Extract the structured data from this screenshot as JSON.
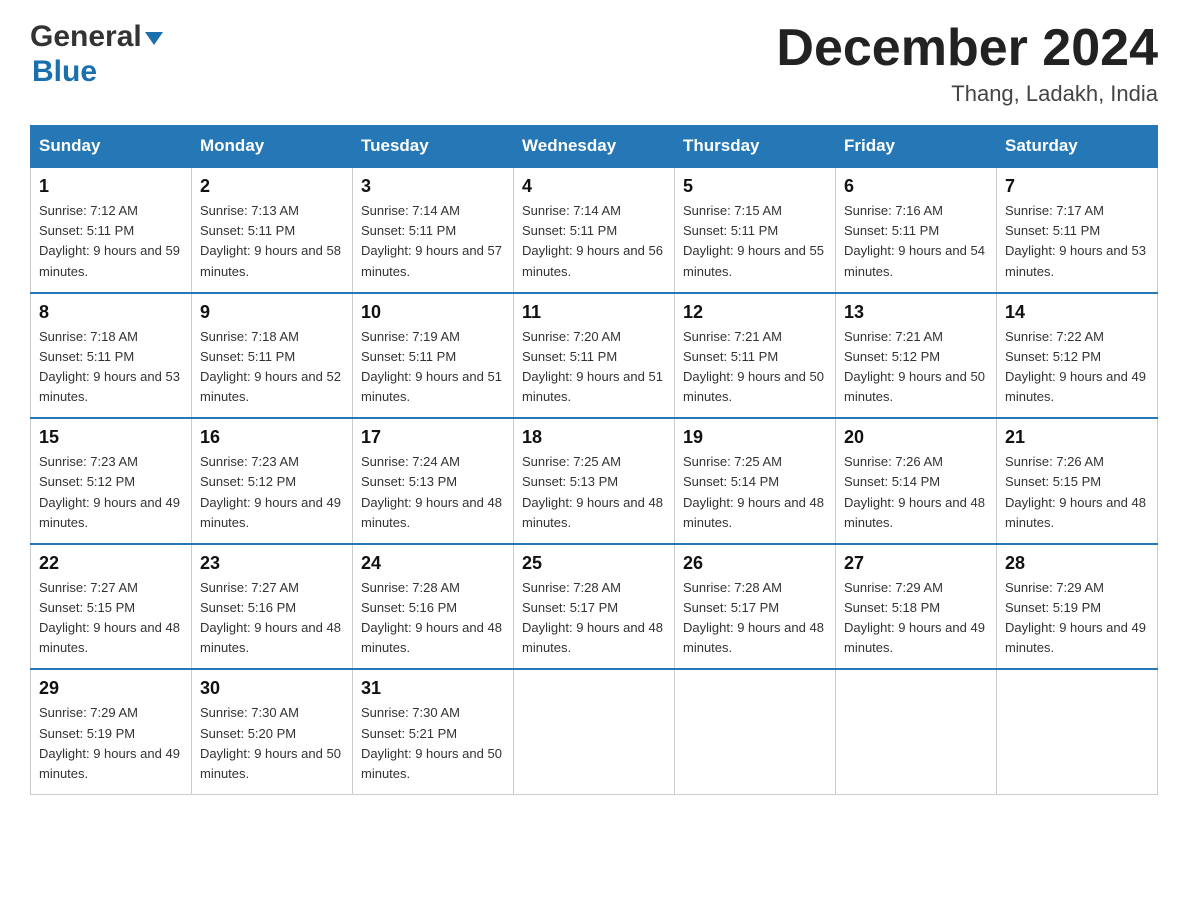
{
  "header": {
    "logo_line1": "General",
    "logo_line2": "Blue",
    "month_year": "December 2024",
    "location": "Thang, Ladakh, India"
  },
  "weekdays": [
    "Sunday",
    "Monday",
    "Tuesday",
    "Wednesday",
    "Thursday",
    "Friday",
    "Saturday"
  ],
  "weeks": [
    [
      {
        "day": "1",
        "sunrise": "7:12 AM",
        "sunset": "5:11 PM",
        "daylight": "9 hours and 59 minutes."
      },
      {
        "day": "2",
        "sunrise": "7:13 AM",
        "sunset": "5:11 PM",
        "daylight": "9 hours and 58 minutes."
      },
      {
        "day": "3",
        "sunrise": "7:14 AM",
        "sunset": "5:11 PM",
        "daylight": "9 hours and 57 minutes."
      },
      {
        "day": "4",
        "sunrise": "7:14 AM",
        "sunset": "5:11 PM",
        "daylight": "9 hours and 56 minutes."
      },
      {
        "day": "5",
        "sunrise": "7:15 AM",
        "sunset": "5:11 PM",
        "daylight": "9 hours and 55 minutes."
      },
      {
        "day": "6",
        "sunrise": "7:16 AM",
        "sunset": "5:11 PM",
        "daylight": "9 hours and 54 minutes."
      },
      {
        "day": "7",
        "sunrise": "7:17 AM",
        "sunset": "5:11 PM",
        "daylight": "9 hours and 53 minutes."
      }
    ],
    [
      {
        "day": "8",
        "sunrise": "7:18 AM",
        "sunset": "5:11 PM",
        "daylight": "9 hours and 53 minutes."
      },
      {
        "day": "9",
        "sunrise": "7:18 AM",
        "sunset": "5:11 PM",
        "daylight": "9 hours and 52 minutes."
      },
      {
        "day": "10",
        "sunrise": "7:19 AM",
        "sunset": "5:11 PM",
        "daylight": "9 hours and 51 minutes."
      },
      {
        "day": "11",
        "sunrise": "7:20 AM",
        "sunset": "5:11 PM",
        "daylight": "9 hours and 51 minutes."
      },
      {
        "day": "12",
        "sunrise": "7:21 AM",
        "sunset": "5:11 PM",
        "daylight": "9 hours and 50 minutes."
      },
      {
        "day": "13",
        "sunrise": "7:21 AM",
        "sunset": "5:12 PM",
        "daylight": "9 hours and 50 minutes."
      },
      {
        "day": "14",
        "sunrise": "7:22 AM",
        "sunset": "5:12 PM",
        "daylight": "9 hours and 49 minutes."
      }
    ],
    [
      {
        "day": "15",
        "sunrise": "7:23 AM",
        "sunset": "5:12 PM",
        "daylight": "9 hours and 49 minutes."
      },
      {
        "day": "16",
        "sunrise": "7:23 AM",
        "sunset": "5:12 PM",
        "daylight": "9 hours and 49 minutes."
      },
      {
        "day": "17",
        "sunrise": "7:24 AM",
        "sunset": "5:13 PM",
        "daylight": "9 hours and 48 minutes."
      },
      {
        "day": "18",
        "sunrise": "7:25 AM",
        "sunset": "5:13 PM",
        "daylight": "9 hours and 48 minutes."
      },
      {
        "day": "19",
        "sunrise": "7:25 AM",
        "sunset": "5:14 PM",
        "daylight": "9 hours and 48 minutes."
      },
      {
        "day": "20",
        "sunrise": "7:26 AM",
        "sunset": "5:14 PM",
        "daylight": "9 hours and 48 minutes."
      },
      {
        "day": "21",
        "sunrise": "7:26 AM",
        "sunset": "5:15 PM",
        "daylight": "9 hours and 48 minutes."
      }
    ],
    [
      {
        "day": "22",
        "sunrise": "7:27 AM",
        "sunset": "5:15 PM",
        "daylight": "9 hours and 48 minutes."
      },
      {
        "day": "23",
        "sunrise": "7:27 AM",
        "sunset": "5:16 PM",
        "daylight": "9 hours and 48 minutes."
      },
      {
        "day": "24",
        "sunrise": "7:28 AM",
        "sunset": "5:16 PM",
        "daylight": "9 hours and 48 minutes."
      },
      {
        "day": "25",
        "sunrise": "7:28 AM",
        "sunset": "5:17 PM",
        "daylight": "9 hours and 48 minutes."
      },
      {
        "day": "26",
        "sunrise": "7:28 AM",
        "sunset": "5:17 PM",
        "daylight": "9 hours and 48 minutes."
      },
      {
        "day": "27",
        "sunrise": "7:29 AM",
        "sunset": "5:18 PM",
        "daylight": "9 hours and 49 minutes."
      },
      {
        "day": "28",
        "sunrise": "7:29 AM",
        "sunset": "5:19 PM",
        "daylight": "9 hours and 49 minutes."
      }
    ],
    [
      {
        "day": "29",
        "sunrise": "7:29 AM",
        "sunset": "5:19 PM",
        "daylight": "9 hours and 49 minutes."
      },
      {
        "day": "30",
        "sunrise": "7:30 AM",
        "sunset": "5:20 PM",
        "daylight": "9 hours and 50 minutes."
      },
      {
        "day": "31",
        "sunrise": "7:30 AM",
        "sunset": "5:21 PM",
        "daylight": "9 hours and 50 minutes."
      },
      null,
      null,
      null,
      null
    ]
  ]
}
